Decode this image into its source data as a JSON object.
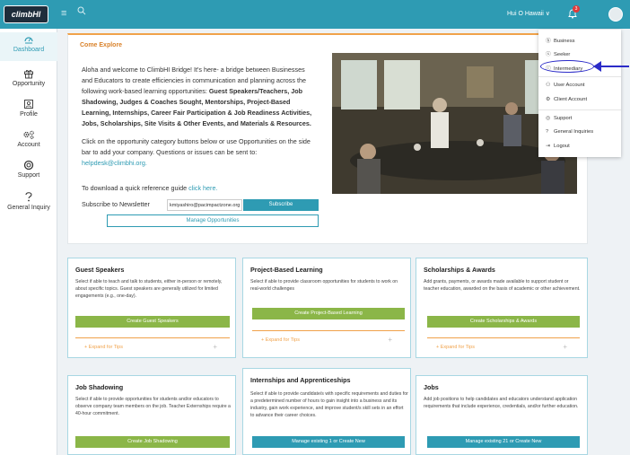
{
  "header": {
    "logo": "climbHI",
    "user_name": "Hui O Hawaii ∨",
    "notification_count": "3"
  },
  "sidebar": {
    "items": [
      {
        "label": "Dashboard",
        "icon": "dashboard-icon"
      },
      {
        "label": "Opportunity",
        "icon": "gift-icon"
      },
      {
        "label": "Profile",
        "icon": "profile-icon"
      },
      {
        "label": "Account",
        "icon": "gears-icon"
      },
      {
        "label": "Support",
        "icon": "support-icon"
      },
      {
        "label": "General Inquiry",
        "icon": "question-icon"
      }
    ]
  },
  "explore": {
    "title": "Come Explore",
    "intro_1": "Aloha and welcome to ClimbHI Bridge! It's here- a bridge between Businesses and Educators to create efficiencies in communication and planning across the following work-based learning opportunities:",
    "intro_bold": "Guest Speakers/Teachers, Job Shadowing, Judges & Coaches Sought, Mentorships, Project-Based Learning, Internships, Career Fair Participation & Job Readiness Activities, Jobs, Scholarships, Site Visits & Other Events, and Materials & Resources.",
    "instructions": "Click on the opportunity category buttons below or use Opportunities on the side bar to add your company. Questions or issues can be sent to:",
    "email": "helpdesk@climbhi.org.",
    "guide_text": "To download a quick reference guide",
    "guide_link": "click here.",
    "newsletter_label": "Subscribe to Newsletter",
    "newsletter_value": "kmiyashiro@pacimpactzone.org",
    "subscribe_label": "Subscribe",
    "manage_label": "Manage Opportunities"
  },
  "tiles": [
    {
      "title": "Guest Speakers",
      "desc": "Select if able to teach and talk to students, either in-person or remotely, about specific topics. Guest speakers are generally utilized for limited engagements (e.g., one-day).",
      "button": "Create Guest Speakers",
      "expand": "+ Expand for Tips"
    },
    {
      "title": "Project-Based Learning",
      "desc": "Select if able to provide classroom opportunities for students to work on real-world challenges",
      "button": "Create Project-Based Learning",
      "expand": "+ Expand for Tips"
    },
    {
      "title": "Scholarships & Awards",
      "desc": "Add grants, payments, or awards made available to support student or teacher education, awarded on the basis of academic or other achievement.",
      "button": "Create Scholarships & Awards",
      "expand": "+ Expand for Tips"
    },
    {
      "title": "Job Shadowing",
      "desc": "Select if able to provide opportunities for students and/or educators to observe company team members on the job.  Teacher Externships require a 40-hour commitment.",
      "button": "Create Job Shadowing"
    },
    {
      "title": "Internships and Apprenticeships",
      "desc": "Select if able to provide candidate/s with specific requirements and duties for a predetermined number of hours to gain insight into a business and its industry, gain work experience, and improve student/s skill sets in an effort to advance their career choices.",
      "button": "Manage existing 1 or Create New"
    },
    {
      "title": "Jobs",
      "desc": "Add job positions to help candidates and educators understand application requirements that include experience, credentials, and/or further education.",
      "button": "Manage existing 21 or Create New"
    }
  ],
  "dropdown": {
    "items": [
      {
        "label": "Business",
        "icon": "ⓑ"
      },
      {
        "label": "Seeker",
        "icon": "ⓢ"
      },
      {
        "label": "Intermediary",
        "icon": "ⓘ"
      },
      {
        "label": "User Account",
        "icon": "⚇"
      },
      {
        "label": "Client Account",
        "icon": "⚙"
      },
      {
        "label": "Support",
        "icon": "◎"
      },
      {
        "label": "General Inquiries",
        "icon": "?"
      },
      {
        "label": "Logout",
        "icon": "⇥"
      }
    ]
  },
  "colors": {
    "header": "#2e9bb3",
    "accent_orange": "#f0a24a",
    "green_button": "#8bb648",
    "teal_button": "#2e9bb3",
    "annotation_blue": "#2b2bc8"
  }
}
